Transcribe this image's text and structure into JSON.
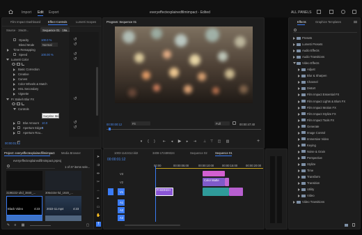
{
  "menu": {
    "items": [
      "Import",
      "Edit",
      "Export"
    ],
    "active": "Edit",
    "file_title": "everyeffectexplainedfilmimpact - Edited",
    "workspace": "ALL PANELS"
  },
  "effect_controls": {
    "tabs": [
      "Film Impact Dashboard",
      "Effect Controls",
      "Lumetri Scopes"
    ],
    "active_tab": "Effect Controls",
    "source": "Source · 19a19...",
    "sequence": "Sequence 01 · 19a...",
    "rows": [
      {
        "label": "Opacity",
        "value": "100.0 %"
      },
      {
        "label": "Blend Mode",
        "value": "Normal"
      },
      {
        "label": "Time Remapping",
        "value": ""
      },
      {
        "label": "Speed",
        "value": "100.00 %"
      },
      {
        "label": "Lumetri Color",
        "value": ""
      },
      {
        "label": "Basic Correction",
        "value": ""
      },
      {
        "label": "Creative",
        "value": ""
      },
      {
        "label": "Curves",
        "value": ""
      },
      {
        "label": "Color Wheels & Match",
        "value": ""
      },
      {
        "label": "HSL Secondary",
        "value": ""
      },
      {
        "label": "Vignette",
        "value": ""
      },
      {
        "label": "FI: Bokeh Blur FX",
        "value": ""
      },
      {
        "label": "Controls",
        "value": ""
      },
      {
        "label": "Blur Amount",
        "value": "10.0"
      },
      {
        "label": "Aperture Edges",
        "value": "5"
      },
      {
        "label": "Aperture Rou...",
        "value": ""
      }
    ],
    "tooltip": "Surprise Me!",
    "timecode": "00:00:01:12"
  },
  "program": {
    "title": "Program: Sequence 01",
    "timecode": "00:00:00:12",
    "fit": "Fit",
    "quality": "Full",
    "duration": "00:00:47:40"
  },
  "effects": {
    "tabs": [
      "Effects",
      "Graphics Templates"
    ],
    "active_tab": "Effects",
    "items": [
      {
        "label": "Presets",
        "indent": 0,
        "open": false
      },
      {
        "label": "Lumetri Presets",
        "indent": 0,
        "open": false
      },
      {
        "label": "Audio Effects",
        "indent": 0,
        "open": false
      },
      {
        "label": "Audio Transitions",
        "indent": 0,
        "open": false
      },
      {
        "label": "Video Effects",
        "indent": 0,
        "open": true
      },
      {
        "label": "Adjust",
        "indent": 1,
        "open": false
      },
      {
        "label": "Blur & Sharpen",
        "indent": 1,
        "open": false
      },
      {
        "label": "Channel",
        "indent": 1,
        "open": false
      },
      {
        "label": "Distort",
        "indent": 1,
        "open": false
      },
      {
        "label": "Film Impact Essential FX",
        "indent": 1,
        "open": false
      },
      {
        "label": "Film Impact Lights & Blurs FX",
        "indent": 1,
        "open": false
      },
      {
        "label": "Film Impact Motion FX",
        "indent": 1,
        "open": false
      },
      {
        "label": "Film Impact Stylize FX",
        "indent": 1,
        "open": false
      },
      {
        "label": "Film Impact Tools FX",
        "indent": 1,
        "open": false
      },
      {
        "label": "Generate",
        "indent": 1,
        "open": false
      },
      {
        "label": "Image Control",
        "indent": 1,
        "open": false
      },
      {
        "label": "Immersive Video",
        "indent": 1,
        "open": false
      },
      {
        "label": "Keying",
        "indent": 1,
        "open": false
      },
      {
        "label": "Noise & Grain",
        "indent": 1,
        "open": false
      },
      {
        "label": "Perspective",
        "indent": 1,
        "open": false
      },
      {
        "label": "Stylize",
        "indent": 1,
        "open": false
      },
      {
        "label": "Time",
        "indent": 1,
        "open": false
      },
      {
        "label": "Transform",
        "indent": 1,
        "open": false
      },
      {
        "label": "Transition",
        "indent": 1,
        "open": false
      },
      {
        "label": "Utility",
        "indent": 1,
        "open": false
      },
      {
        "label": "Video",
        "indent": 1,
        "open": false
      },
      {
        "label": "Video Transitions",
        "indent": 0,
        "open": false
      }
    ]
  },
  "project": {
    "tabs": [
      "Project: everyeffectexplainedfilmimpact",
      "Media Browser"
    ],
    "path": "everyeffectexplainedfilmimpact.prproj",
    "selected": "1 of 37 items sele...",
    "thumbs": [
      {
        "name": "3196222-uhd_3840_...",
        "dur": ""
      },
      {
        "name": "3064334-hd_1920_...",
        "dur": ""
      },
      {
        "name": "Black Video",
        "dur": "4:23"
      },
      {
        "name": "2022-11.mp4",
        "dur": "4:23"
      }
    ]
  },
  "timeline": {
    "tabs": [
      "1003-1142412.kit2",
      "3408-172489324",
      "Sequence 02",
      "Sequence 01"
    ],
    "active_tab": "Sequence 01",
    "timecode": "00:00:01:12",
    "ruler": [
      "00:00",
      "00:00:05:00",
      "00:00:10:00",
      "00:00:15:00",
      "00:00:20:00"
    ],
    "tracks_video": [
      "V3",
      "V2",
      "V1"
    ],
    "tracks_audio": [
      "A1",
      "A2",
      "A3"
    ],
    "clip_v1": "FI-BOKEH",
    "clip_v3": "Color Matte"
  },
  "colors": {
    "accent": "#3b7cf5",
    "clip_pink": "#d35fd1",
    "clip_purple": "#7f5ac9",
    "clip_teal": "#2f9b9a"
  }
}
